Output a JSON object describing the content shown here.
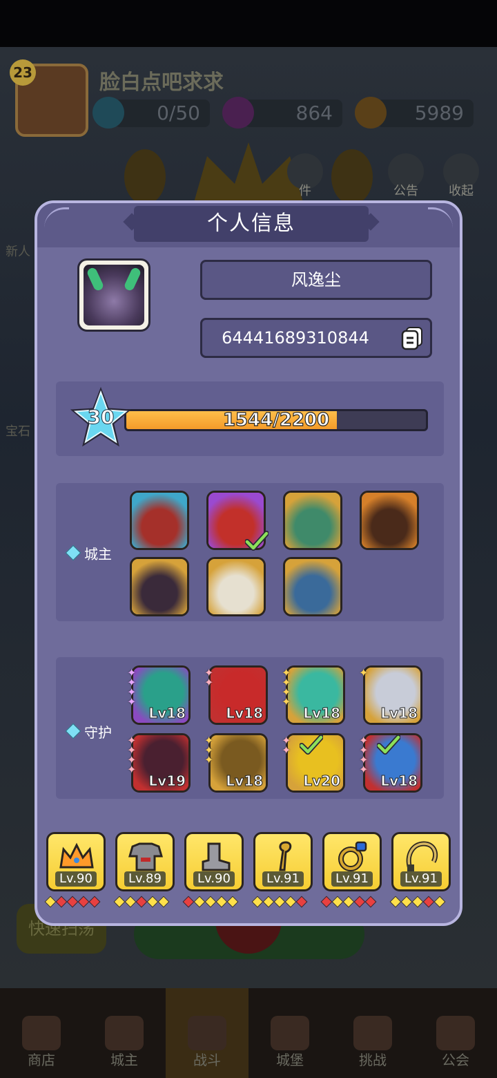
{
  "background": {
    "player_level": "23",
    "player_name": "脸白点吧求求",
    "energy": "0/50",
    "gems": "864",
    "gold": "5989",
    "top_icons": [
      "件",
      "公告",
      "收起"
    ],
    "side_labels": [
      "新人",
      "宝石"
    ],
    "quick_button": "快速扫荡",
    "nav": [
      {
        "label": "商店",
        "icon": "shop-icon"
      },
      {
        "label": "城主",
        "icon": "lord-icon"
      },
      {
        "label": "战斗",
        "icon": "battle-icon"
      },
      {
        "label": "城堡",
        "icon": "castle-icon"
      },
      {
        "label": "挑战",
        "icon": "challenge-icon"
      },
      {
        "label": "公会",
        "icon": "guild-icon"
      }
    ]
  },
  "modal": {
    "title": "个人信息",
    "nickname": "风逸尘",
    "player_id": "64441689310844",
    "level": "30",
    "xp_text": "1544/2200",
    "xp_fraction": 0.7018,
    "lords": {
      "label": "城主",
      "items": [
        {
          "name": "elf-lady",
          "selected": false
        },
        {
          "name": "red-sorceress",
          "selected": true
        },
        {
          "name": "green-dryad",
          "selected": false
        },
        {
          "name": "fire-golem",
          "selected": false
        },
        {
          "name": "demon-hunter",
          "selected": false
        },
        {
          "name": "old-sage",
          "selected": false
        },
        {
          "name": "skull-king",
          "selected": false
        }
      ]
    },
    "guardians": {
      "label": "守护",
      "items": [
        {
          "name": "teal-dragon",
          "level": "Lv18",
          "stars": 4,
          "star_color": "purple",
          "selected": false
        },
        {
          "name": "red-dragon",
          "level": "Lv18",
          "stars": 2,
          "star_color": "pink",
          "selected": false
        },
        {
          "name": "jade-dragon",
          "level": "Lv18",
          "stars": 4,
          "star_color": "gold",
          "selected": false
        },
        {
          "name": "white-dragon",
          "level": "Lv18",
          "stars": 1,
          "star_color": "gold",
          "selected": false
        },
        {
          "name": "shadow-dragon",
          "level": "Lv19",
          "stars": 4,
          "star_color": "pink",
          "selected": false
        },
        {
          "name": "tree-dragon",
          "level": "Lv18",
          "stars": 3,
          "star_color": "gold",
          "selected": false
        },
        {
          "name": "gold-dragon",
          "level": "Lv20",
          "stars": 2,
          "star_color": "pink",
          "selected": true
        },
        {
          "name": "ice-dragon",
          "level": "Lv18",
          "stars": 4,
          "star_color": "pink",
          "selected": true
        }
      ]
    },
    "equipment": [
      {
        "name": "crown",
        "level": "Lv.90",
        "diamonds": [
          "yellow",
          "red",
          "red",
          "red",
          "red"
        ]
      },
      {
        "name": "armor",
        "level": "Lv.89",
        "diamonds": [
          "yellow",
          "yellow",
          "red",
          "yellow",
          "yellow"
        ]
      },
      {
        "name": "boots",
        "level": "Lv.90",
        "diamonds": [
          "red",
          "yellow",
          "yellow",
          "yellow",
          "yellow"
        ]
      },
      {
        "name": "staff",
        "level": "Lv.91",
        "diamonds": [
          "yellow",
          "yellow",
          "yellow",
          "yellow",
          "red"
        ]
      },
      {
        "name": "ring",
        "level": "Lv.91",
        "diamonds": [
          "red",
          "yellow",
          "yellow",
          "red",
          "red"
        ]
      },
      {
        "name": "amulet",
        "level": "Lv.91",
        "diamonds": [
          "yellow",
          "yellow",
          "yellow",
          "red",
          "yellow"
        ]
      }
    ]
  }
}
